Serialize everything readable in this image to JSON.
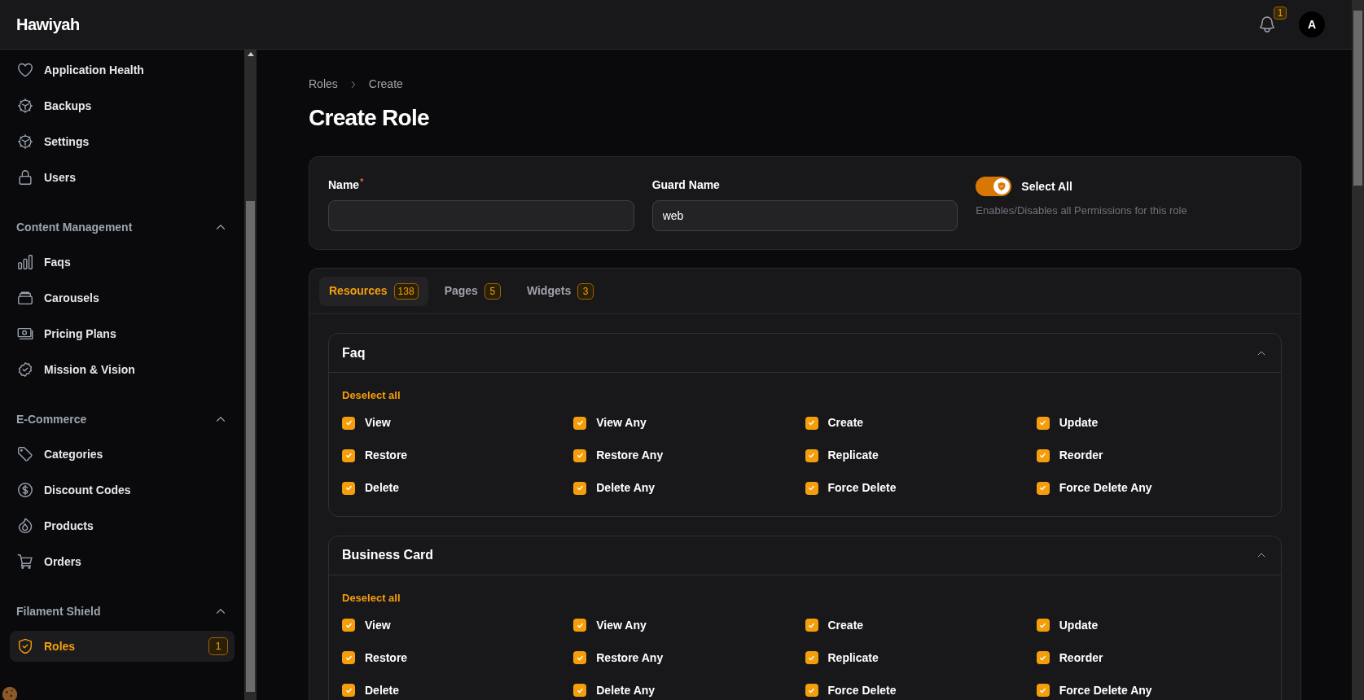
{
  "topbar": {
    "brand": "Hawiyah",
    "notification_count": "1",
    "avatar": "A"
  },
  "sidebar": {
    "groups": [
      {
        "items": [
          {
            "label": "Application Health",
            "selected": false
          },
          {
            "label": "Backups",
            "selected": false
          },
          {
            "label": "Settings",
            "selected": false
          },
          {
            "label": "Users",
            "selected": false
          }
        ]
      },
      {
        "label": "Content Management",
        "expanded": true,
        "items": [
          {
            "label": "Faqs",
            "selected": false
          },
          {
            "label": "Carousels",
            "selected": false
          },
          {
            "label": "Pricing Plans",
            "selected": false
          },
          {
            "label": "Mission & Vision",
            "selected": false
          }
        ]
      },
      {
        "label": "E-Commerce",
        "expanded": true,
        "items": [
          {
            "label": "Categories",
            "selected": false
          },
          {
            "label": "Discount Codes",
            "selected": false
          },
          {
            "label": "Products",
            "selected": false
          },
          {
            "label": "Orders",
            "selected": false
          }
        ]
      },
      {
        "label": "Filament Shield",
        "expanded": true,
        "items": [
          {
            "label": "Roles",
            "selected": true,
            "badge": "1"
          }
        ]
      }
    ]
  },
  "breadcrumbs": [
    "Roles",
    "Create"
  ],
  "page_title": "Create Role",
  "form": {
    "name": {
      "label": "Name",
      "required_mark": "*"
    },
    "guard_name": {
      "label": "Guard Name",
      "value": "web"
    },
    "select_all": {
      "label": "Select All",
      "description": "Enables/Disables all Permissions for this role",
      "on": true
    }
  },
  "tabs": [
    {
      "label": "Resources",
      "count": "138",
      "selected": true
    },
    {
      "label": "Pages",
      "count": "5",
      "selected": false
    },
    {
      "label": "Widgets",
      "count": "3",
      "selected": false
    }
  ],
  "sections": [
    {
      "title": "Faq",
      "expanded": true,
      "action": "Deselect all",
      "permissions": [
        {
          "label": "View",
          "checked": true
        },
        {
          "label": "View Any",
          "checked": true
        },
        {
          "label": "Create",
          "checked": true
        },
        {
          "label": "Update",
          "checked": true
        },
        {
          "label": "Restore",
          "checked": true
        },
        {
          "label": "Restore Any",
          "checked": true
        },
        {
          "label": "Replicate",
          "checked": true
        },
        {
          "label": "Reorder",
          "checked": true
        },
        {
          "label": "Delete",
          "checked": true
        },
        {
          "label": "Delete Any",
          "checked": true
        },
        {
          "label": "Force Delete",
          "checked": true
        },
        {
          "label": "Force Delete Any",
          "checked": true
        }
      ]
    },
    {
      "title": "Business Card",
      "expanded": true,
      "action": "Deselect all",
      "permissions": [
        {
          "label": "View",
          "checked": true
        },
        {
          "label": "View Any",
          "checked": true
        },
        {
          "label": "Create",
          "checked": true
        },
        {
          "label": "Update",
          "checked": true
        },
        {
          "label": "Restore",
          "checked": true
        },
        {
          "label": "Restore Any",
          "checked": true
        },
        {
          "label": "Replicate",
          "checked": true
        },
        {
          "label": "Reorder",
          "checked": true
        },
        {
          "label": "Delete",
          "checked": true
        },
        {
          "label": "Delete Any",
          "checked": true
        },
        {
          "label": "Force Delete",
          "checked": true
        },
        {
          "label": "Force Delete Any",
          "checked": true
        }
      ]
    }
  ]
}
